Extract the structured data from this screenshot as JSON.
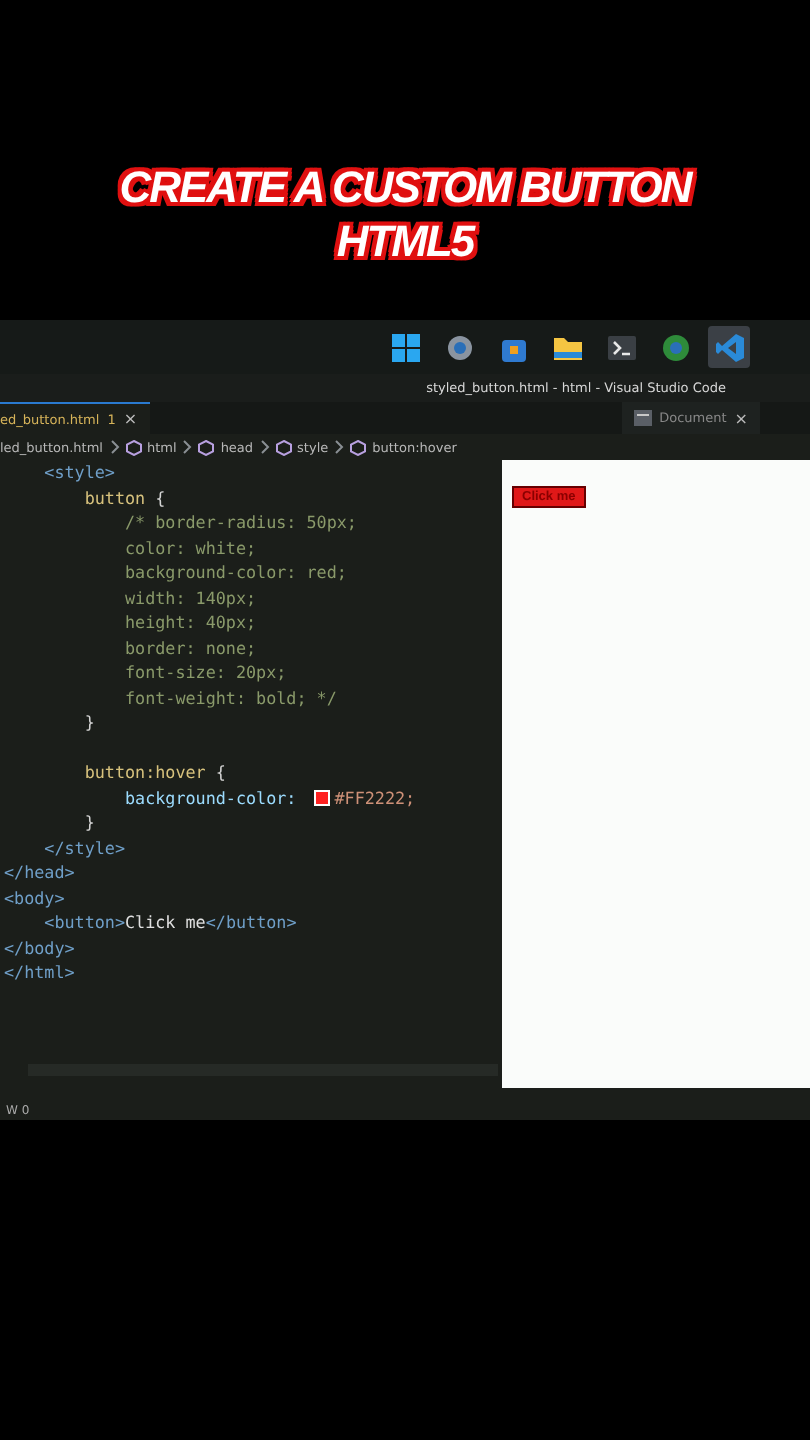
{
  "video_title": {
    "lines": [
      "CREATE A  CUSTOM BUTTON",
      "HTML5"
    ]
  },
  "taskbar": {
    "apps": [
      {
        "kind": "start",
        "selected": false
      },
      {
        "kind": "settings",
        "selected": false
      },
      {
        "kind": "store",
        "selected": false
      },
      {
        "kind": "folder",
        "selected": false
      },
      {
        "kind": "terminal",
        "selected": false
      },
      {
        "kind": "browser",
        "selected": false
      },
      {
        "kind": "editor",
        "selected": true
      }
    ]
  },
  "window": {
    "title": "styled_button.html - html - Visual Studio Code"
  },
  "tabs": [
    {
      "label": "ed_button.html",
      "badge": "1",
      "close": "×",
      "selected": true
    },
    {
      "label": "Document",
      "close": "×",
      "selected": false
    }
  ],
  "breadcrumb": [
    "led_button.html",
    "html",
    "head",
    "style",
    "button:hover"
  ],
  "code_lines": [
    [
      {
        "kind": "tag",
        "text": "    <style>"
      }
    ],
    [
      {
        "kind": "selector",
        "text": "        button"
      },
      {
        "kind": "punct",
        "text": " {"
      }
    ],
    [
      {
        "kind": "comment",
        "text": "            /* border-radius: 50px;"
      }
    ],
    [
      {
        "kind": "comment",
        "text": "            color: white;"
      }
    ],
    [
      {
        "kind": "comment",
        "text": "            background-color: red;"
      }
    ],
    [
      {
        "kind": "comment",
        "text": "            width: 140px;"
      }
    ],
    [
      {
        "kind": "comment",
        "text": "            height: 40px;"
      }
    ],
    [
      {
        "kind": "comment",
        "text": "            border: none;"
      }
    ],
    [
      {
        "kind": "comment",
        "text": "            font-size: 20px;"
      }
    ],
    [
      {
        "kind": "comment",
        "text": "            font-weight: bold; */"
      }
    ],
    [
      {
        "kind": "punct",
        "text": "        }"
      }
    ],
    [
      {
        "kind": "blank"
      }
    ],
    [
      {
        "kind": "selector",
        "text": "        button:hover"
      },
      {
        "kind": "punct",
        "text": " {"
      }
    ],
    [
      {
        "kind": "property",
        "text": "            background-color: "
      },
      {
        "kind": "swatch",
        "color": "#ff2222"
      },
      {
        "kind": "value",
        "text": "#FF2222;"
      }
    ],
    [
      {
        "kind": "punct",
        "text": "        }"
      }
    ],
    [
      {
        "kind": "tag",
        "text": "    </style>"
      }
    ],
    [
      {
        "kind": "tag",
        "text": "</head>"
      }
    ],
    [
      {
        "kind": "tag",
        "text": "<body>"
      }
    ],
    [
      {
        "kind": "tag",
        "text": "    <button>"
      },
      {
        "kind": "text",
        "text": "Click me"
      },
      {
        "kind": "tag",
        "text": "</button>"
      }
    ],
    [
      {
        "kind": "tag",
        "text": "</body>"
      }
    ],
    [
      {
        "kind": "tag",
        "text": "</html>"
      }
    ]
  ],
  "preview": {
    "button": "Click me"
  },
  "status_bar": {
    "text": "W 0"
  }
}
